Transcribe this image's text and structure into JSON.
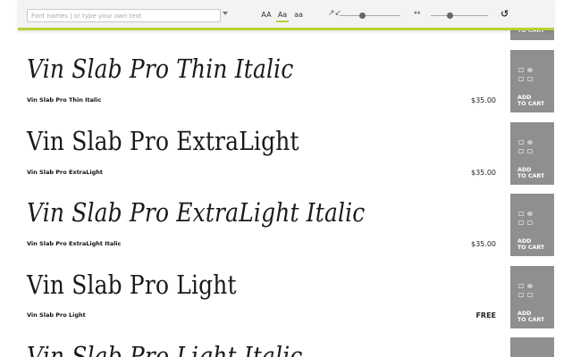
{
  "toolbar": {
    "search_placeholder": "Font names | or type your own text",
    "case_upper": "AA",
    "case_title": "Aa",
    "case_lower": "aa",
    "size_icon": "↗↙",
    "spacing_icon": "↔",
    "reset_icon": "↺"
  },
  "cart_top_label_line2": "TO CART",
  "fonts": [
    {
      "sample": "Vin Slab Pro Thin Italic",
      "name": "Vin Slab Pro Thin Italic",
      "price": "$35.00",
      "cart_line1": "ADD",
      "cart_line2": "TO CART"
    },
    {
      "sample": "Vin Slab Pro ExtraLight",
      "name": "Vin Slab Pro ExtraLight",
      "price": "$35.00",
      "cart_line1": "ADD",
      "cart_line2": "TO CART"
    },
    {
      "sample": "Vin Slab Pro ExtraLight Italic",
      "name": "Vin Slab Pro ExtraLight Italic",
      "price": "$35.00",
      "cart_line1": "ADD",
      "cart_line2": "TO CART"
    },
    {
      "sample": "Vin Slab Pro Light",
      "name": "Vin Slab Pro Light",
      "price": "FREE",
      "cart_line1": "ADD",
      "cart_line2": "TO CART"
    },
    {
      "sample": "Vin Slab Pro Light Italic"
    }
  ]
}
